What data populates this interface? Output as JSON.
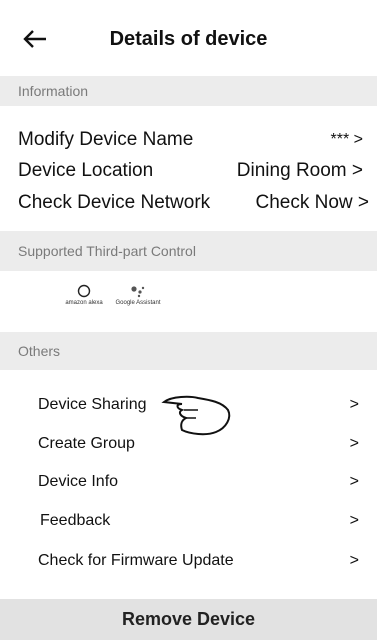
{
  "header": {
    "title": "Details of device",
    "back_icon": "arrow-left-icon"
  },
  "information": {
    "section_label": "Information",
    "items": [
      {
        "label": "Modify Device Name",
        "value": "*** >"
      },
      {
        "label": "Device Location",
        "value": "Dining Room >"
      },
      {
        "label": "Check Device Network",
        "value": "Check Now >"
      }
    ]
  },
  "third_party": {
    "section_label": "Supported Third-part Control",
    "logos": [
      {
        "name": "amazon alexa",
        "icon": "alexa-icon"
      },
      {
        "name": "Google Assistant",
        "icon": "google-assistant-icon"
      }
    ]
  },
  "others": {
    "section_label": "Others",
    "items": [
      {
        "label": "Device Sharing",
        "chevron": ">"
      },
      {
        "label": "Create Group",
        "chevron": ">"
      },
      {
        "label": "Device Info",
        "chevron": ">"
      },
      {
        "label": "Feedback",
        "chevron": ">"
      },
      {
        "label": "Check for Firmware Update",
        "chevron": ">"
      }
    ]
  },
  "footer": {
    "remove_label": "Remove Device"
  }
}
